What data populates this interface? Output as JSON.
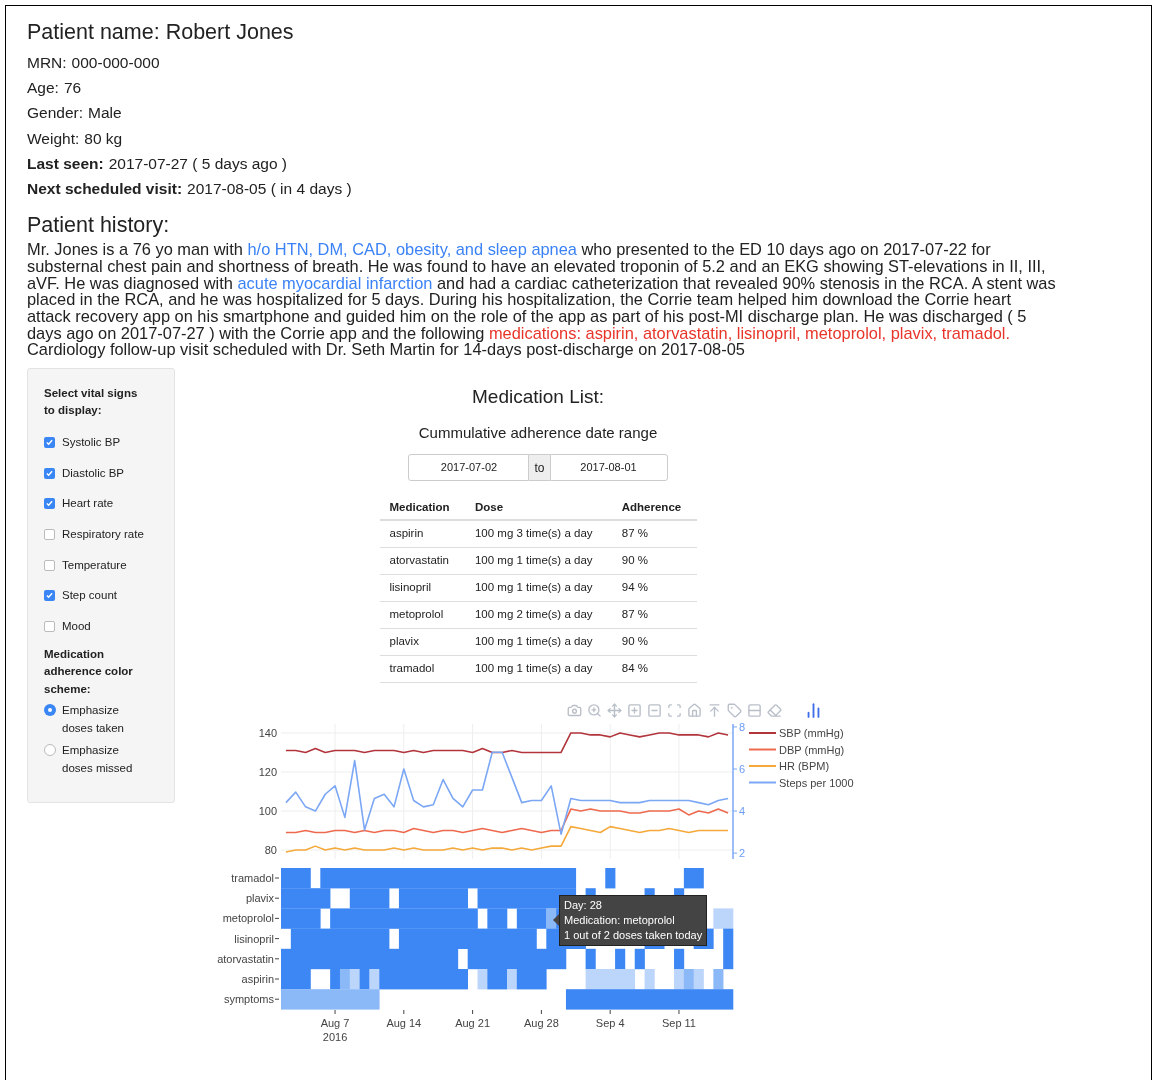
{
  "patient": {
    "name_label": "Patient name:",
    "name": "Robert Jones",
    "details": [
      {
        "label": "MRN:",
        "value": "000-000-000",
        "label_bold": false
      },
      {
        "label": "Age:",
        "value": "76",
        "label_bold": false
      },
      {
        "label": "Gender:",
        "value": "Male",
        "label_bold": false
      },
      {
        "label": "Weight:",
        "value": "80 kg",
        "label_bold": false
      },
      {
        "label": "Last seen:",
        "value": "2017-07-27 ( 5 days ago )",
        "label_bold": true
      },
      {
        "label": "Next scheduled visit:",
        "value": "2017-08-05 ( in 4 days )",
        "label_bold": true
      }
    ]
  },
  "history": {
    "title": "Patient history:",
    "segments": [
      {
        "kind": "text",
        "text": "Mr. Jones is a 76 yo man with "
      },
      {
        "kind": "link",
        "text": "h/o HTN, DM, CAD, obesity, and sleep apnea"
      },
      {
        "kind": "text",
        "text": " who presented to the ED 10 days ago on 2017-07-22 for substernal chest pain and shortness of breath. He was found to have an elevated troponin of 5.2 and an EKG showing ST-elevations in II, III, aVF. He was diagnosed with "
      },
      {
        "kind": "link",
        "text": "acute myocardial infarction"
      },
      {
        "kind": "text",
        "text": " and had a cardiac catheterization that revealed 90% stenosis in the RCA. A stent was placed in the RCA, and he was hospitalized for 5 days. During his hospitalization, the Corrie team helped him download the Corrie heart attack recovery app on his smartphone and guided him on the role of the app as part of his post-MI discharge plan. He was discharged ( 5 days ago on 2017-07-27 ) with the Corrie app and the following "
      },
      {
        "kind": "alert",
        "text": "medications: aspirin, atorvastatin, lisinopril, metoprolol, plavix, tramadol."
      },
      {
        "kind": "text",
        "text": " Cardiology follow-up visit scheduled with Dr. Seth Martin for 14-days post-discharge on 2017-08-05"
      }
    ]
  },
  "sidebar": {
    "vitals_title": "Select vital signs to display:",
    "vitals": [
      {
        "label": "Systolic BP",
        "checked": true
      },
      {
        "label": "Diastolic BP",
        "checked": true
      },
      {
        "label": "Heart rate",
        "checked": true
      },
      {
        "label": "Respiratory rate",
        "checked": false
      },
      {
        "label": "Temperature",
        "checked": false
      },
      {
        "label": "Step count",
        "checked": true
      },
      {
        "label": "Mood",
        "checked": false
      }
    ],
    "scheme_title": "Medication adherence color scheme:",
    "schemes": [
      {
        "label": "Emphasize doses taken",
        "selected": true
      },
      {
        "label": "Emphasize doses missed",
        "selected": false
      }
    ]
  },
  "medication_list": {
    "title": "Medication List:",
    "range_label": "Cummulative adherence date range",
    "start_date": "2017-07-02",
    "separator": "to",
    "end_date": "2017-08-01",
    "columns": [
      "Medication",
      "Dose",
      "Adherence"
    ],
    "rows": [
      [
        "aspirin",
        "100 mg 3 time(s) a day",
        "87 %"
      ],
      [
        "atorvastatin",
        "100 mg 1 time(s) a day",
        "90 %"
      ],
      [
        "lisinopril",
        "100 mg 1 time(s) a day",
        "94 %"
      ],
      [
        "metoprolol",
        "100 mg 2 time(s) a day",
        "87 %"
      ],
      [
        "plavix",
        "100 mg 1 time(s) a day",
        "90 %"
      ],
      [
        "tramadol",
        "100 mg 1 time(s) a day",
        "84 %"
      ]
    ]
  },
  "vitals_chart": {
    "chart_data": {
      "type": "line",
      "ylim": [
        75.4,
        144.6
      ],
      "yticks": [
        80,
        100,
        120,
        140
      ],
      "y2lim": [
        1.72,
        8.14
      ],
      "y2ticks": [
        2,
        4,
        6,
        8
      ],
      "grid": true,
      "legend": "right",
      "series": [
        {
          "name": "SBP (mmHg)",
          "color": "#b2353c",
          "values": [
            131,
            131,
            130,
            132,
            130,
            131,
            131,
            131,
            130,
            131,
            131,
            131,
            130,
            131,
            130,
            131,
            131,
            131,
            131,
            130,
            132,
            130,
            130,
            131,
            130,
            130,
            130,
            130,
            130,
            140,
            140,
            139,
            139,
            138,
            140,
            139,
            138,
            139,
            140,
            140,
            139,
            139,
            139,
            138,
            140,
            139
          ]
        },
        {
          "name": "DBP (mmHg)",
          "color": "#ee6a4f",
          "values": [
            89,
            89,
            90,
            89,
            89,
            90,
            90,
            89,
            90,
            89,
            90,
            90,
            89,
            91,
            90,
            89,
            90,
            90,
            89,
            90,
            91,
            90,
            89,
            90,
            91,
            90,
            89,
            90,
            90,
            101,
            100,
            101,
            100,
            100,
            100,
            99,
            99,
            100,
            100,
            100,
            101,
            98,
            100,
            99,
            101,
            99
          ]
        },
        {
          "name": "HR (BPM)",
          "color": "#f5a93a",
          "values": [
            79,
            80,
            80,
            82,
            80,
            81,
            80,
            81,
            80,
            80,
            80,
            81,
            80,
            81,
            80,
            80,
            80,
            81,
            80,
            81,
            80,
            81,
            81,
            80,
            81,
            80,
            81,
            82,
            82,
            92,
            91,
            90,
            89,
            92,
            91,
            90,
            89,
            90,
            90,
            91,
            90,
            89,
            90,
            90,
            90,
            90
          ]
        },
        {
          "name": "Steps per 1000",
          "color": "#7ba7f4",
          "axis": "y2",
          "values": [
            4.4,
            4.9,
            4.2,
            4.0,
            4.8,
            5.2,
            3.7,
            6.4,
            3.1,
            4.6,
            4.8,
            4.2,
            6.0,
            4.5,
            4.2,
            4.3,
            5.5,
            4.6,
            4.2,
            5.0,
            5.0,
            6.8,
            6.8,
            5.6,
            4.4,
            4.5,
            4.5,
            5.2,
            2.9,
            4.6,
            4.5,
            4.5,
            4.5,
            4.5,
            4.4,
            4.4,
            4.4,
            4.5,
            4.5,
            4.5,
            4.5,
            4.5,
            4.4,
            4.3,
            4.5,
            4.6
          ]
        }
      ]
    }
  },
  "adherence_heatmap": {
    "rows": [
      "tramadol",
      "plavix",
      "metoprolol",
      "lisinopril",
      "atorvastatin",
      "aspirin",
      "symptoms"
    ],
    "xticks": [
      "Aug 7",
      "Aug 14",
      "Aug 21",
      "Aug 28",
      "Sep 4",
      "Sep 11"
    ],
    "year_label": "2016",
    "tooltip": [
      "Day: 28",
      "Medication: metoprolol",
      "1 out of 2 doses taken today"
    ]
  }
}
